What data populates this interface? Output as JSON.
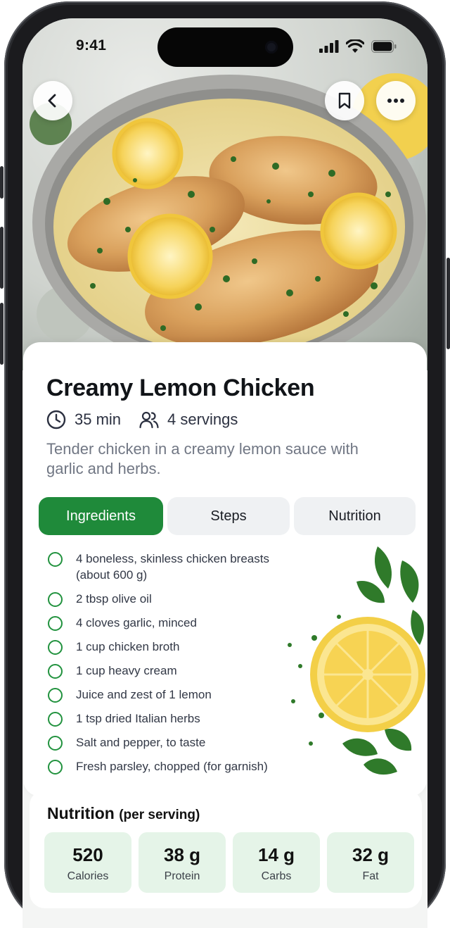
{
  "status_bar": {
    "time": "9:41"
  },
  "recipe": {
    "title": "Creamy Lemon Chicken",
    "time": "35 min",
    "servings": "4 servings",
    "description": "Tender chicken in a creamy lemon sauce with garlic and herbs."
  },
  "tabs": [
    {
      "label": "Ingredients",
      "active": true
    },
    {
      "label": "Steps",
      "active": false
    },
    {
      "label": "Nutrition",
      "active": false
    }
  ],
  "ingredients": [
    "4 boneless, skinless chicken breasts (about 600 g)",
    "2 tbsp olive oil",
    "4 cloves garlic, minced",
    "1 cup chicken broth",
    "1 cup heavy cream",
    "Juice and zest of 1 lemon",
    "1 tsp dried Italian herbs",
    "Salt and pepper, to taste",
    "Fresh parsley, chopped (for garnish)"
  ],
  "nutrition": {
    "title": "Nutrition",
    "subtitle": "(per serving)",
    "items": [
      {
        "value": "520",
        "label": "Calories"
      },
      {
        "value": "38 g",
        "label": "Protein"
      },
      {
        "value": "14 g",
        "label": "Carbs"
      },
      {
        "value": "32 g",
        "label": "Fat"
      }
    ]
  },
  "colors": {
    "accent": "#1f8a3a",
    "tab_inactive": "#eff1f3",
    "nutrition_box": "#e5f4e8"
  },
  "icons": [
    "back-icon",
    "bookmark-icon",
    "more-icon",
    "clock-icon",
    "users-icon",
    "signal-icon",
    "wifi-icon",
    "battery-icon",
    "check-circle-icon"
  ]
}
